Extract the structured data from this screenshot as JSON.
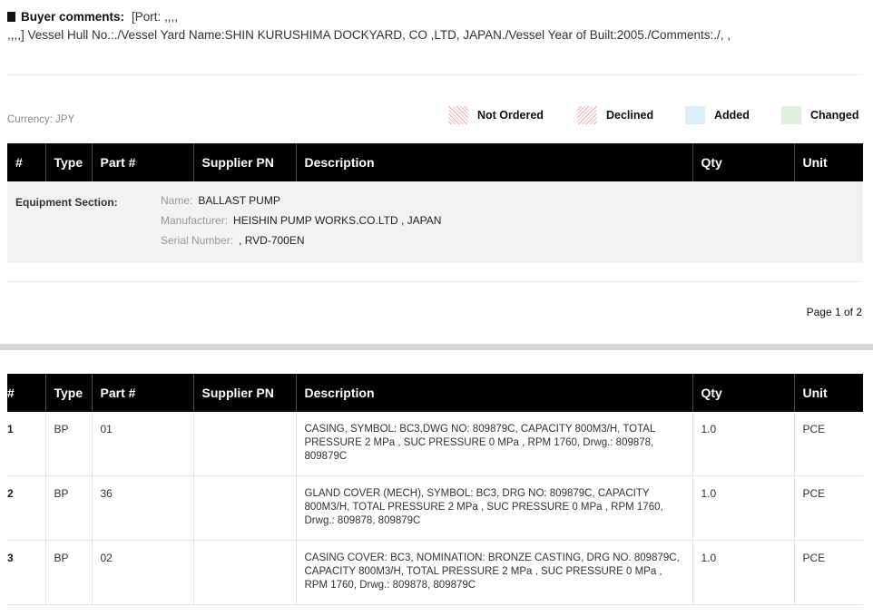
{
  "comments": {
    "label": "Buyer comments:",
    "line1": "[Port: ,,,,",
    "line2": ",,,,] Vessel Hull No.:./Vessel Yard Name:SHIN KURUSHIMA DOCKYARD, CO ,LTD, JAPAN./Vessel Year of Built:2005./Comments:./, ,"
  },
  "currency": "Currency: JPY",
  "legend": [
    {
      "label": "Not Ordered",
      "color": "#f3a9a9"
    },
    {
      "label": "Declined",
      "color": "#f3a9a9"
    },
    {
      "label": "Added",
      "color": "#dbeefa"
    },
    {
      "label": "Changed",
      "color": "#dcf0d9"
    }
  ],
  "columns": [
    "#",
    "Type",
    "Part #",
    "Supplier PN",
    "Description",
    "Qty",
    "Unit"
  ],
  "equipment": {
    "title": "Equipment Section:",
    "name_label": "Name:",
    "name": "BALLAST PUMP",
    "manufacturer_label": "Manufacturer:",
    "manufacturer": "HEISHIN PUMP WORKS.CO.LTD , JAPAN",
    "serial_label": "Serial Number:",
    "serial": ", RVD-700EN"
  },
  "page_number": "Page 1 of 2",
  "rows": [
    {
      "num": "1",
      "type": "BP",
      "part": "01",
      "supplier_pn": "",
      "desc": "CASING, SYMBOL: BC3,DWG NO: 809879C, CAPACITY 800M3/H, TOTAL PRESSURE 2 MPa , SUC PRESSURE 0 MPa , RPM 1760, Drwg.: 809878, 809879C",
      "qty": "1.0",
      "unit": "PCE"
    },
    {
      "num": "2",
      "type": "BP",
      "part": "36",
      "supplier_pn": "",
      "desc": "GLAND COVER (MECH), SYMBOL: BC3, DRG NO: 809879C, CAPACITY 800M3/H, TOTAL PRESSURE 2 MPa , SUC PRESSURE 0 MPa , RPM 1760, Drwg.: 809878, 809879C",
      "qty": "1.0",
      "unit": "PCE"
    },
    {
      "num": "3",
      "type": "BP",
      "part": "02",
      "supplier_pn": "",
      "desc": "CASING COVER: BC3, NOMINATION: BRONZE CASTING, DRG NO. 809879C, CAPACITY 800M3/H, TOTAL PRESSURE 2 MPa , SUC PRESSURE 0 MPa , RPM 1760, Drwg.: 809878, 809879C",
      "qty": "1.0",
      "unit": "PCE"
    }
  ]
}
